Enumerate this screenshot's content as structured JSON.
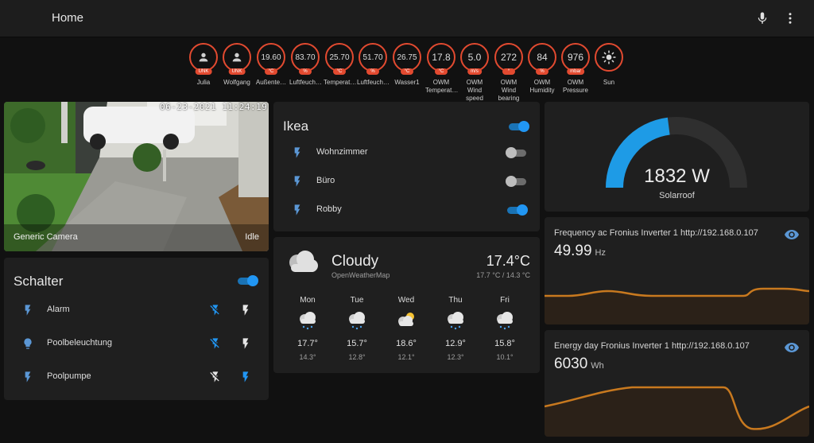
{
  "header": {
    "title": "Home",
    "mic_icon": "microphone-icon",
    "menu_icon": "dots-vertical-icon"
  },
  "badges": [
    {
      "kind": "person",
      "unit": "UNK",
      "label": "Julia"
    },
    {
      "kind": "person",
      "unit": "UNK",
      "label": "Wolfgang"
    },
    {
      "value": "19.60",
      "unit": "°C",
      "label": "Außente…"
    },
    {
      "value": "83.70",
      "unit": "%",
      "label": "Luftfeuch…"
    },
    {
      "value": "25.70",
      "unit": "°C",
      "label": "Temperat…"
    },
    {
      "value": "51.70",
      "unit": "%",
      "label": "Luftfeuch…"
    },
    {
      "value": "26.75",
      "unit": "°C",
      "label": "Wasser1"
    },
    {
      "value": "17.8",
      "unit": "°C",
      "label": "OWM Temperat…"
    },
    {
      "value": "5.0",
      "unit": "m/s",
      "label": "OWM Wind speed"
    },
    {
      "value": "272",
      "unit": "°",
      "label": "OWM Wind bearing"
    },
    {
      "value": "84",
      "unit": "%",
      "label": "OWM Humidity"
    },
    {
      "value": "976",
      "unit": "mbar",
      "label": "OWM Pressure"
    },
    {
      "kind": "sun",
      "label": "Sun"
    }
  ],
  "camera": {
    "name": "Generic Camera",
    "state": "Idle",
    "timestamp": "06-23-2021 11:24:19"
  },
  "schalter": {
    "title": "Schalter",
    "master_on": true,
    "rows": [
      {
        "name": "Alarm",
        "icon": "flash-icon",
        "off_active": true,
        "on_active": false
      },
      {
        "name": "Poolbeleuchtung",
        "icon": "lightbulb-icon",
        "off_active": true,
        "on_active": false
      },
      {
        "name": "Poolpumpe",
        "icon": "flash-icon",
        "off_active": false,
        "on_active": true
      }
    ]
  },
  "ikea": {
    "title": "Ikea",
    "master_on": true,
    "rows": [
      {
        "name": "Wohnzimmer",
        "on": false
      },
      {
        "name": "Büro",
        "on": false
      },
      {
        "name": "Robby",
        "on": true
      }
    ]
  },
  "weather": {
    "condition": "Cloudy",
    "source": "OpenWeatherMap",
    "temperature": "17.4°C",
    "hilo": "17.7 °C / 14.3 °C",
    "forecast": [
      {
        "day": "Mon",
        "icon": "snowy-rainy",
        "hi": "17.7°",
        "lo": "14.3°"
      },
      {
        "day": "Tue",
        "icon": "snowy-rainy",
        "hi": "15.7°",
        "lo": "12.8°"
      },
      {
        "day": "Wed",
        "icon": "partly-cloudy",
        "hi": "18.6°",
        "lo": "12.1°"
      },
      {
        "day": "Thu",
        "icon": "snowy-rainy",
        "hi": "12.9°",
        "lo": "12.3°"
      },
      {
        "day": "Fri",
        "icon": "snowy-rainy",
        "hi": "15.8°",
        "lo": "10.1°"
      }
    ]
  },
  "gauge": {
    "value": "1832 W",
    "name": "Solarroof",
    "fraction": 0.46,
    "color": "#1e9be6"
  },
  "sensors": [
    {
      "title": "Frequency ac Fronius Inverter 1 http://192.168.0.107",
      "value": "49.99",
      "unit": "Hz",
      "icon": "eye-icon"
    },
    {
      "title": "Energy day Fronius Inverter 1 http://192.168.0.107",
      "value": "6030",
      "unit": "Wh",
      "icon": "eye-icon"
    }
  ],
  "colors": {
    "accent": "#2196f3",
    "badge_red": "#e24a30",
    "graph": "#c8791f",
    "card": "#1f1f1f",
    "background": "#111111"
  }
}
